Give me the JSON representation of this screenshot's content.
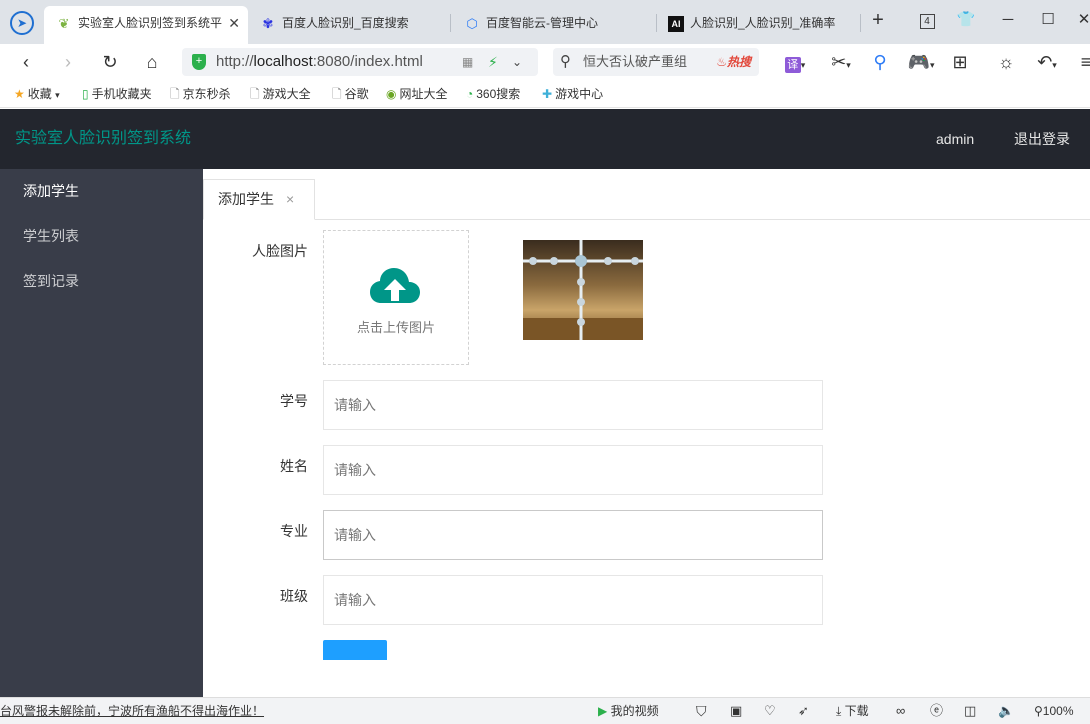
{
  "browser": {
    "tabs": [
      {
        "title": "实验室人脸识别签到系统平",
        "icon": "leaf-icon",
        "active": true
      },
      {
        "title": "百度人脸识别_百度搜索",
        "icon": "baidu-paw-icon",
        "active": false
      },
      {
        "title": "百度智能云-管理中心",
        "icon": "cloud-hex-icon",
        "active": false
      },
      {
        "title": "人脸识别_人脸识别_准确率",
        "icon": "ai-icon",
        "active": false
      }
    ],
    "tab_count": "4",
    "url_prefix": "http://",
    "url_host": "localhost",
    "url_rest": ":8080/index.html",
    "search_text": "恒大否认破产重组",
    "search_hot": "热搜",
    "bookmarks": [
      {
        "label": "收藏",
        "icon": "star-icon"
      },
      {
        "label": "手机收藏夹",
        "icon": "phone-icon"
      },
      {
        "label": "京东秒杀",
        "icon": "page-icon"
      },
      {
        "label": "游戏大全",
        "icon": "page-icon"
      },
      {
        "label": "谷歌",
        "icon": "page-icon"
      },
      {
        "label": "网址大全",
        "icon": "globe-icon"
      },
      {
        "label": "360搜索",
        "icon": "search-360-icon"
      },
      {
        "label": "游戏中心",
        "icon": "gamepad-icon"
      }
    ],
    "translate_label": "译"
  },
  "app": {
    "title": "实验室人脸识别签到系统",
    "user": "admin",
    "logout": "退出登录",
    "sidebar": [
      {
        "label": "添加学生",
        "active": true
      },
      {
        "label": "学生列表",
        "active": false
      },
      {
        "label": "签到记录",
        "active": false
      }
    ],
    "tab": {
      "label": "添加学生",
      "close": "×"
    },
    "form": {
      "face_label": "人脸图片",
      "upload_text": "点击上传图片",
      "fields": [
        {
          "label": "学号",
          "placeholder": "请输入"
        },
        {
          "label": "姓名",
          "placeholder": "请输入"
        },
        {
          "label": "专业",
          "placeholder": "请输入"
        },
        {
          "label": "班级",
          "placeholder": "请输入"
        }
      ]
    }
  },
  "statusbar": {
    "news": "台风警报未解除前，宁波所有渔船不得出海作业！",
    "video": "我的视频",
    "download": "下载",
    "zoom": "100%"
  },
  "colors": {
    "header_bg": "#23262e",
    "sidebar_bg": "#393d49",
    "accent": "#009688",
    "button": "#1e9fff"
  }
}
